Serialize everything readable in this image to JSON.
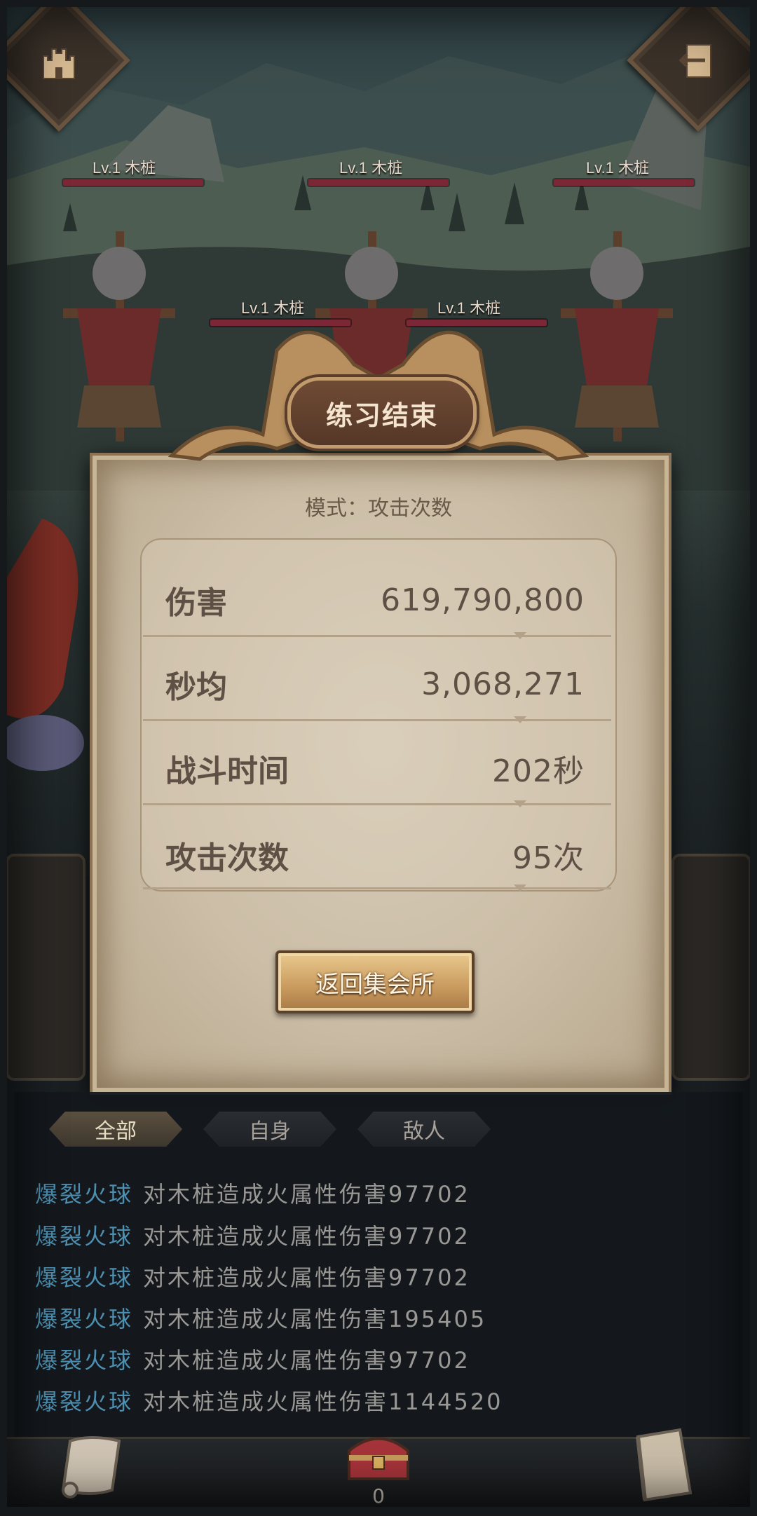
{
  "result": {
    "title": "练习结束",
    "mode": "模式：攻击次数",
    "stats": [
      {
        "label": "伤害",
        "value": "619,790,800"
      },
      {
        "label": "秒均",
        "value": "3,068,271"
      },
      {
        "label": "战斗时间",
        "value": "202秒"
      },
      {
        "label": "攻击次数",
        "value": "95次"
      }
    ],
    "return_button": "返回集会所"
  },
  "enemies": [
    {
      "label": "Lv.1  木桩",
      "hp_fraction": 1.0
    },
    {
      "label": "Lv.1  木桩",
      "hp_fraction": 1.0
    },
    {
      "label": "Lv.1  木桩",
      "hp_fraction": 1.0
    },
    {
      "label": "Lv.1  木桩",
      "hp_fraction": 1.0
    },
    {
      "label": "Lv.1  木桩",
      "hp_fraction": 1.0
    }
  ],
  "log": {
    "tabs": [
      "全部",
      "自身",
      "敌人"
    ],
    "active_tab": "全部",
    "entries": [
      {
        "skill": "爆裂火球",
        "text": "对木桩造成火属性伤害97702"
      },
      {
        "skill": "爆裂火球",
        "text": "对木桩造成火属性伤害97702"
      },
      {
        "skill": "爆裂火球",
        "text": "对木桩造成火属性伤害97702"
      },
      {
        "skill": "爆裂火球",
        "text": "对木桩造成火属性伤害195405"
      },
      {
        "skill": "爆裂火球",
        "text": "对木桩造成火属性伤害97702"
      },
      {
        "skill": "爆裂火球",
        "text": "对木桩造成火属性伤害1144520"
      }
    ]
  },
  "bottom": {
    "chest_count": "0"
  },
  "icons": {
    "top_left": "castle-icon",
    "top_right": "exit-door-icon",
    "bottom_left": "scroll-icon",
    "bottom_center": "treasure-chest-icon",
    "bottom_right": "book-icon"
  },
  "colors": {
    "skill_text": "#4c8fb0",
    "log_text": "#9a9895",
    "hp_bar": "#7b2736",
    "panel_bg": "#cbbda6",
    "title_plate": "#553727"
  }
}
